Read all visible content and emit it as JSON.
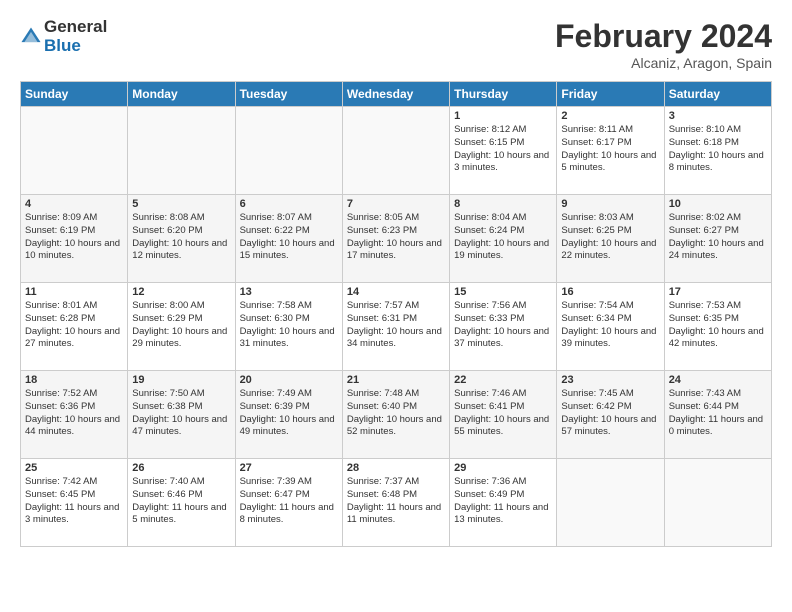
{
  "logo": {
    "general": "General",
    "blue": "Blue"
  },
  "title": "February 2024",
  "subtitle": "Alcaniz, Aragon, Spain",
  "days_of_week": [
    "Sunday",
    "Monday",
    "Tuesday",
    "Wednesday",
    "Thursday",
    "Friday",
    "Saturday"
  ],
  "weeks": [
    [
      {
        "num": "",
        "detail": ""
      },
      {
        "num": "",
        "detail": ""
      },
      {
        "num": "",
        "detail": ""
      },
      {
        "num": "",
        "detail": ""
      },
      {
        "num": "1",
        "detail": "Sunrise: 8:12 AM\nSunset: 6:15 PM\nDaylight: 10 hours\nand 3 minutes."
      },
      {
        "num": "2",
        "detail": "Sunrise: 8:11 AM\nSunset: 6:17 PM\nDaylight: 10 hours\nand 5 minutes."
      },
      {
        "num": "3",
        "detail": "Sunrise: 8:10 AM\nSunset: 6:18 PM\nDaylight: 10 hours\nand 8 minutes."
      }
    ],
    [
      {
        "num": "4",
        "detail": "Sunrise: 8:09 AM\nSunset: 6:19 PM\nDaylight: 10 hours\nand 10 minutes."
      },
      {
        "num": "5",
        "detail": "Sunrise: 8:08 AM\nSunset: 6:20 PM\nDaylight: 10 hours\nand 12 minutes."
      },
      {
        "num": "6",
        "detail": "Sunrise: 8:07 AM\nSunset: 6:22 PM\nDaylight: 10 hours\nand 15 minutes."
      },
      {
        "num": "7",
        "detail": "Sunrise: 8:05 AM\nSunset: 6:23 PM\nDaylight: 10 hours\nand 17 minutes."
      },
      {
        "num": "8",
        "detail": "Sunrise: 8:04 AM\nSunset: 6:24 PM\nDaylight: 10 hours\nand 19 minutes."
      },
      {
        "num": "9",
        "detail": "Sunrise: 8:03 AM\nSunset: 6:25 PM\nDaylight: 10 hours\nand 22 minutes."
      },
      {
        "num": "10",
        "detail": "Sunrise: 8:02 AM\nSunset: 6:27 PM\nDaylight: 10 hours\nand 24 minutes."
      }
    ],
    [
      {
        "num": "11",
        "detail": "Sunrise: 8:01 AM\nSunset: 6:28 PM\nDaylight: 10 hours\nand 27 minutes."
      },
      {
        "num": "12",
        "detail": "Sunrise: 8:00 AM\nSunset: 6:29 PM\nDaylight: 10 hours\nand 29 minutes."
      },
      {
        "num": "13",
        "detail": "Sunrise: 7:58 AM\nSunset: 6:30 PM\nDaylight: 10 hours\nand 31 minutes."
      },
      {
        "num": "14",
        "detail": "Sunrise: 7:57 AM\nSunset: 6:31 PM\nDaylight: 10 hours\nand 34 minutes."
      },
      {
        "num": "15",
        "detail": "Sunrise: 7:56 AM\nSunset: 6:33 PM\nDaylight: 10 hours\nand 37 minutes."
      },
      {
        "num": "16",
        "detail": "Sunrise: 7:54 AM\nSunset: 6:34 PM\nDaylight: 10 hours\nand 39 minutes."
      },
      {
        "num": "17",
        "detail": "Sunrise: 7:53 AM\nSunset: 6:35 PM\nDaylight: 10 hours\nand 42 minutes."
      }
    ],
    [
      {
        "num": "18",
        "detail": "Sunrise: 7:52 AM\nSunset: 6:36 PM\nDaylight: 10 hours\nand 44 minutes."
      },
      {
        "num": "19",
        "detail": "Sunrise: 7:50 AM\nSunset: 6:38 PM\nDaylight: 10 hours\nand 47 minutes."
      },
      {
        "num": "20",
        "detail": "Sunrise: 7:49 AM\nSunset: 6:39 PM\nDaylight: 10 hours\nand 49 minutes."
      },
      {
        "num": "21",
        "detail": "Sunrise: 7:48 AM\nSunset: 6:40 PM\nDaylight: 10 hours\nand 52 minutes."
      },
      {
        "num": "22",
        "detail": "Sunrise: 7:46 AM\nSunset: 6:41 PM\nDaylight: 10 hours\nand 55 minutes."
      },
      {
        "num": "23",
        "detail": "Sunrise: 7:45 AM\nSunset: 6:42 PM\nDaylight: 10 hours\nand 57 minutes."
      },
      {
        "num": "24",
        "detail": "Sunrise: 7:43 AM\nSunset: 6:44 PM\nDaylight: 11 hours\nand 0 minutes."
      }
    ],
    [
      {
        "num": "25",
        "detail": "Sunrise: 7:42 AM\nSunset: 6:45 PM\nDaylight: 11 hours\nand 3 minutes."
      },
      {
        "num": "26",
        "detail": "Sunrise: 7:40 AM\nSunset: 6:46 PM\nDaylight: 11 hours\nand 5 minutes."
      },
      {
        "num": "27",
        "detail": "Sunrise: 7:39 AM\nSunset: 6:47 PM\nDaylight: 11 hours\nand 8 minutes."
      },
      {
        "num": "28",
        "detail": "Sunrise: 7:37 AM\nSunset: 6:48 PM\nDaylight: 11 hours\nand 11 minutes."
      },
      {
        "num": "29",
        "detail": "Sunrise: 7:36 AM\nSunset: 6:49 PM\nDaylight: 11 hours\nand 13 minutes."
      },
      {
        "num": "",
        "detail": ""
      },
      {
        "num": "",
        "detail": ""
      }
    ]
  ]
}
